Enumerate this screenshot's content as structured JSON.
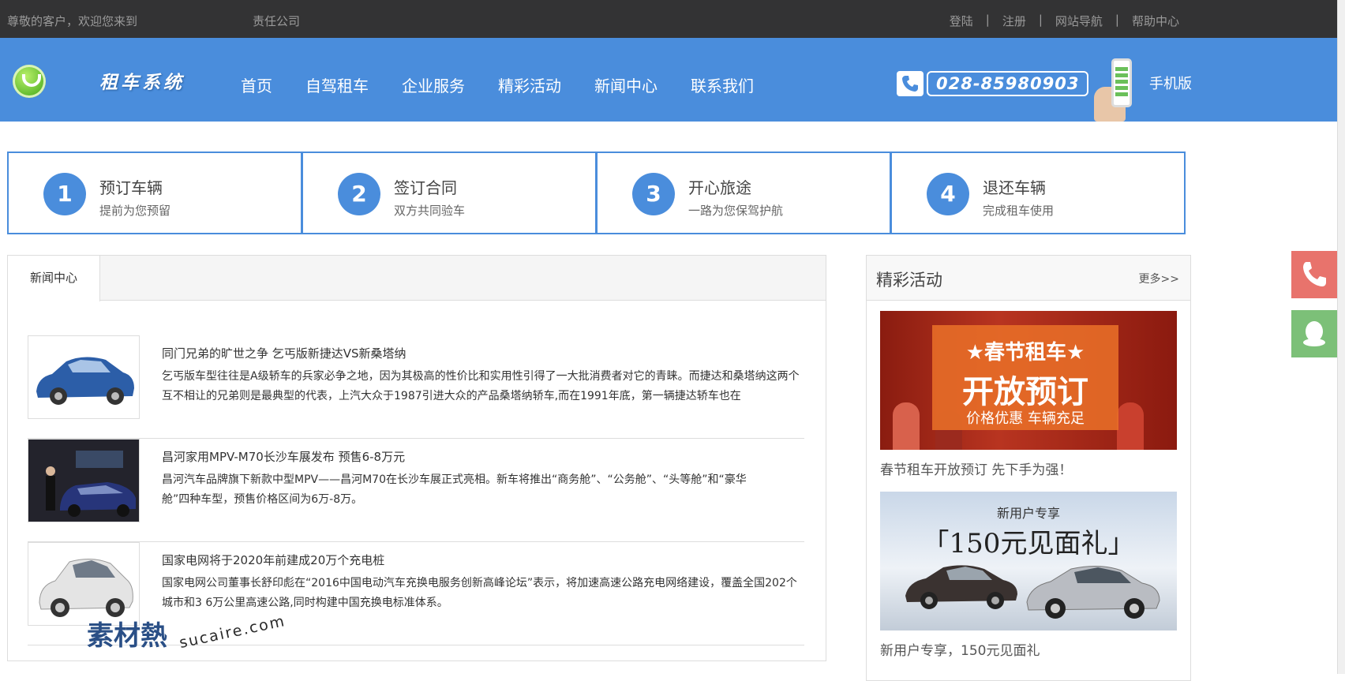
{
  "topbar": {
    "welcome": "尊敬的客户，欢迎您来到",
    "company": "责任公司",
    "links": [
      "登陆",
      "注册",
      "网站导航",
      "帮助中心"
    ]
  },
  "header": {
    "title": "租车系统",
    "nav": [
      "首页",
      "自驾租车",
      "企业服务",
      "精彩活动",
      "新闻中心",
      "联系我们"
    ],
    "phone": "028-85980903",
    "mobile_label": "手机版"
  },
  "steps": [
    {
      "num": "1",
      "title": "预订车辆",
      "sub": "提前为您预留"
    },
    {
      "num": "2",
      "title": "签订合同",
      "sub": "双方共同验车"
    },
    {
      "num": "3",
      "title": "开心旅途",
      "sub": "一路为您保驾护航"
    },
    {
      "num": "4",
      "title": "退还车辆",
      "sub": "完成租车使用"
    }
  ],
  "news": {
    "tab": "新闻中心",
    "items": [
      {
        "title": "同门兄弟的旷世之争 乞丐版新捷达VS新桑塔纳",
        "desc": "乞丐版车型往往是A级轿车的兵家必争之地，因为其极高的性价比和实用性引得了一大批消费者对它的青睐。而捷达和桑塔纳这两个互不相让的兄弟则是最典型的代表，上汽大众于1987引进大众的产品桑塔纳轿车,而在1991年底，第一辆捷达轿车也在"
      },
      {
        "title": "昌河家用MPV-M70长沙车展发布 预售6-8万元",
        "desc": "昌河汽车品牌旗下新款中型MPV——昌河M70在长沙车展正式亮相。新车将推出“商务舱”、“公务舱”、“头等舱”和“豪华舱”四种车型，预售价格区间为6万-8万。"
      },
      {
        "title": "国家电网将于2020年前建成20万个充电桩",
        "desc": "国家电网公司董事长舒印彪在“2016中国电动汽车充换电服务创新高峰论坛”表示，将加速高速公路充电网络建设，覆盖全国202个城市和3 6万公里高速公路,同时构建中国充换电标准体系。"
      }
    ]
  },
  "activities": {
    "title": "精彩活动",
    "more": "更多>>",
    "promo1": {
      "line1": "★春节租车★",
      "line2": "开放预订",
      "line3": "价格优惠 车辆充足",
      "caption": "春节租车开放预订 先下手为强！"
    },
    "promo2": {
      "line1": "新用户专享",
      "line2": "「150元见面礼」",
      "caption": "新用户专享，150元见面礼"
    }
  },
  "watermark": {
    "brand": "素材熱",
    "site": "sucaire.com"
  },
  "colors": {
    "primary": "#4a8ddc",
    "topbar": "#333334",
    "phone_float": "#e8736c",
    "qq_float": "#7cc078"
  }
}
